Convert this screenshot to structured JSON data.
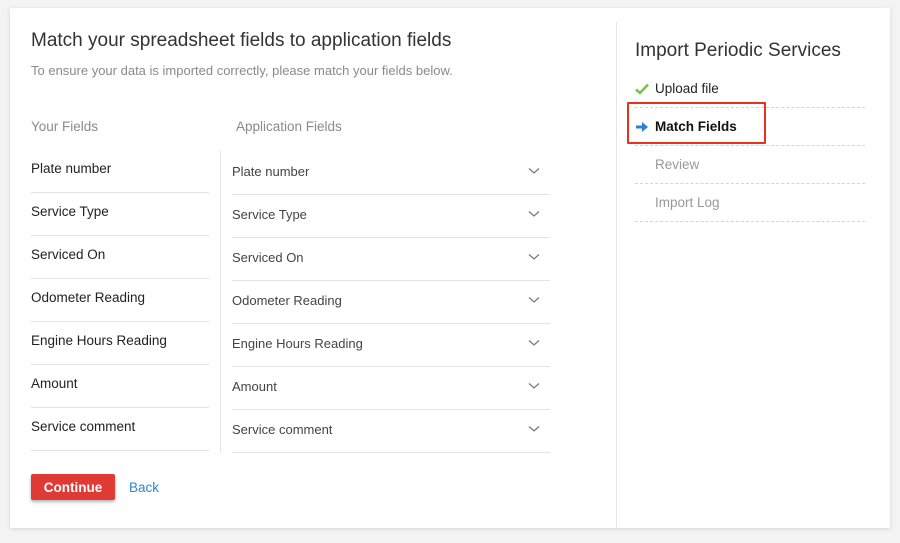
{
  "main": {
    "title": "Match your spreadsheet fields to application fields",
    "subtitle": "To ensure your data is imported correctly, please match your fields below.",
    "columns": {
      "your_fields": "Your Fields",
      "application_fields": "Application Fields"
    },
    "rows": [
      {
        "your_field": "Plate number",
        "application_field": "Plate number"
      },
      {
        "your_field": "Service Type",
        "application_field": "Service Type"
      },
      {
        "your_field": "Serviced On",
        "application_field": "Serviced On"
      },
      {
        "your_field": "Odometer Reading",
        "application_field": "Odometer Reading"
      },
      {
        "your_field": "Engine Hours Reading",
        "application_field": "Engine Hours Reading"
      },
      {
        "your_field": "Amount",
        "application_field": "Amount"
      },
      {
        "your_field": "Service comment",
        "application_field": "Service comment"
      }
    ],
    "continue_label": "Continue",
    "back_label": "Back"
  },
  "sidebar": {
    "title": "Import Periodic Services",
    "steps": [
      {
        "label": "Upload file",
        "state": "done",
        "icon": "check-icon"
      },
      {
        "label": "Match Fields",
        "state": "active",
        "icon": "arrow-right-icon"
      },
      {
        "label": "Review",
        "state": "pending"
      },
      {
        "label": "Import Log",
        "state": "pending"
      }
    ]
  },
  "colors": {
    "primary_button": "#e03a35",
    "link": "#2a86d8",
    "check": "#7cc242",
    "active_arrow": "#2a7fd6",
    "highlight_border": "#e8321c"
  }
}
